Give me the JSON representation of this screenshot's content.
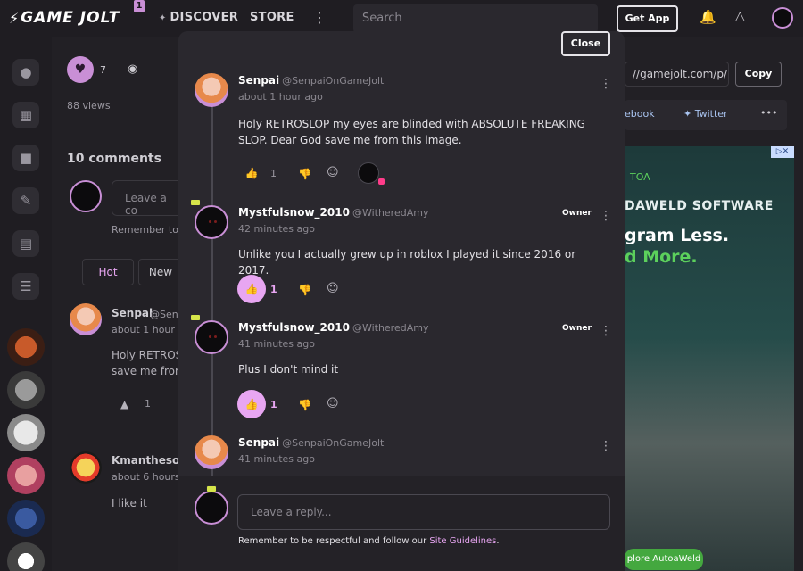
{
  "nav": {
    "logo": "GAME JOLT",
    "notif_count": "1",
    "discover": "DISCOVER",
    "store": "STORE",
    "search_placeholder": "Search",
    "get_app": "Get App"
  },
  "background": {
    "like_count": "7",
    "views": "88 views",
    "comments_heading": "10 comments",
    "leave_comment": "Leave a co",
    "remember": "Remember to b",
    "tab_hot": "Hot",
    "tab_new": "New",
    "comment1_name": "Senpai",
    "comment1_handle": "@Senp",
    "comment1_time": "about 1 hour ag",
    "comment1_line1": "Holy RETROS",
    "comment1_line2": "save me from",
    "comment1_likes": "1",
    "comment2_name": "Kmanthesoni",
    "comment2_time": "about 6 hours a",
    "comment2_body": "I like it",
    "share_url": "//gamejolt.com/p/like",
    "copy": "Copy",
    "facebook": "ebook",
    "twitter": "Twitter",
    "more": "•••"
  },
  "ad": {
    "small": "TOA",
    "line1": "DAWELD SOFTWARE",
    "line2": "gram Less.",
    "line3": "d More.",
    "button": "plore AutoaWeld"
  },
  "modal": {
    "close": "Close",
    "comments": [
      {
        "name": "Senpai",
        "handle": "@SenpaiOnGameJolt",
        "time": "about 1 hour ago",
        "body": "Holy RETROSLOP my eyes are blinded with ABSOLUTE FREAKING SLOP. Dear God save me from this image.",
        "likes": "1"
      },
      {
        "name": "Mystfulsnow_2010",
        "handle": "@WitheredAmy",
        "badge": "Owner",
        "time": "42 minutes ago",
        "body": "Unlike you I actually grew up in roblox I played it since 2016 or 2017.",
        "likes": "1"
      },
      {
        "name": "Mystfulsnow_2010",
        "handle": "@WitheredAmy",
        "badge": "Owner",
        "time": "41 minutes ago",
        "body": "Plus I don't mind it",
        "likes": "1"
      },
      {
        "name": "Senpai",
        "handle": "@SenpaiOnGameJolt",
        "time": "41 minutes ago"
      }
    ],
    "reply_placeholder": "Leave a reply...",
    "reply_note": "Remember to be respectful and follow our ",
    "reply_link": "Site Guidelines",
    "reply_note_end": "."
  },
  "colors": {
    "accent": "#c98fd6",
    "like_active": "#e8a6f2",
    "background": "#1a181d",
    "modal": "#2a282e"
  }
}
